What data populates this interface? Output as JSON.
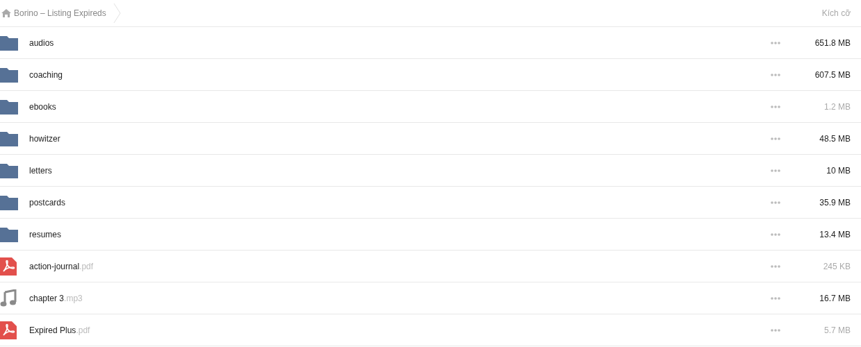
{
  "breadcrumb": {
    "title": "Borino – Listing Expireds"
  },
  "columns": {
    "size": "Kích cỡ"
  },
  "rows": [
    {
      "kind": "folder",
      "name": "audios",
      "size": "651.8 MB",
      "muted": false
    },
    {
      "kind": "folder",
      "name": "coaching",
      "size": "607.5 MB",
      "muted": false
    },
    {
      "kind": "folder",
      "name": "ebooks",
      "size": "1.2 MB",
      "muted": true
    },
    {
      "kind": "folder",
      "name": "howitzer",
      "size": "48.5 MB",
      "muted": false
    },
    {
      "kind": "folder",
      "name": "letters",
      "size": "10 MB",
      "muted": false
    },
    {
      "kind": "folder",
      "name": "postcards",
      "size": "35.9 MB",
      "muted": false
    },
    {
      "kind": "folder",
      "name": "resumes",
      "size": "13.4 MB",
      "muted": false
    },
    {
      "kind": "pdf",
      "name": "action-journal",
      "extension": ".pdf",
      "size": "245 KB",
      "muted": true
    },
    {
      "kind": "audio",
      "name": "chapter 3",
      "extension": ".mp3",
      "size": "16.7 MB",
      "muted": false
    },
    {
      "kind": "pdf",
      "name": "Expired Plus",
      "extension": ".pdf",
      "size": "5.7 MB",
      "muted": true
    }
  ]
}
